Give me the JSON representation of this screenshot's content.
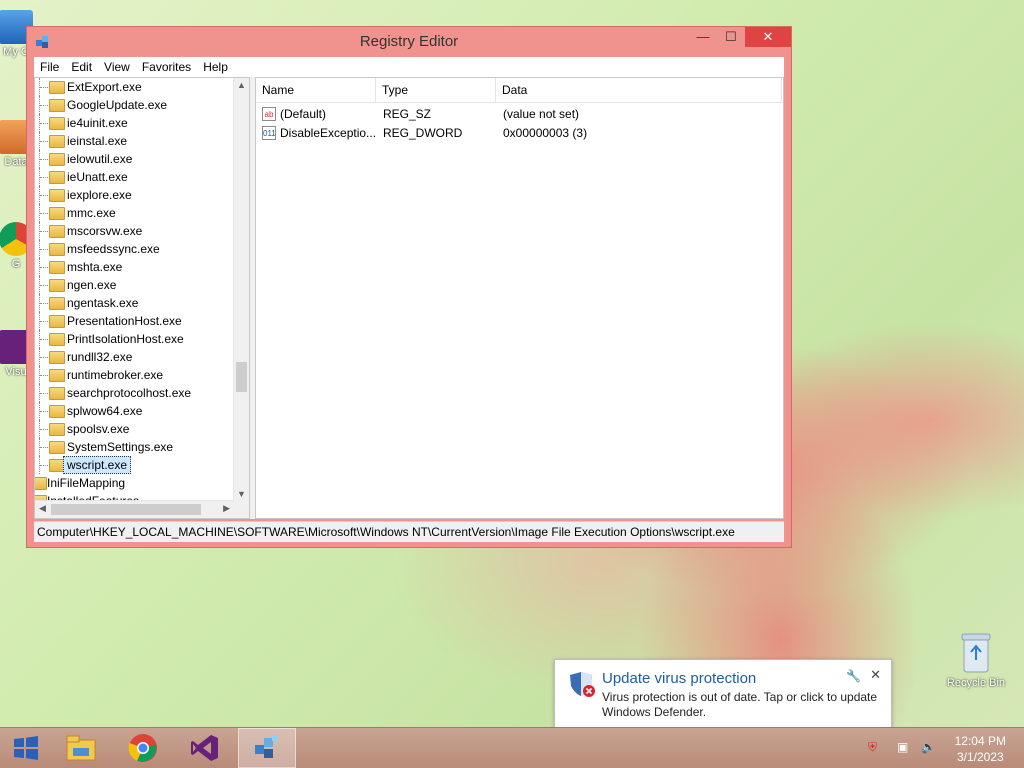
{
  "desktop": {
    "icons": [
      {
        "label": "My C",
        "name": "my-computer-icon"
      },
      {
        "label": "Data",
        "name": "data-icon"
      },
      {
        "label": "G",
        "name": "chrome-desktop-icon"
      },
      {
        "label": "Visu",
        "name": "visual-studio-desktop-icon"
      }
    ],
    "recycle_bin": "Recycle Bin"
  },
  "window": {
    "title": "Registry Editor",
    "buttons": {
      "minimize": "—",
      "maximize": "☐",
      "close": "✕"
    },
    "menu": [
      "File",
      "Edit",
      "View",
      "Favorites",
      "Help"
    ],
    "tree": {
      "items": [
        "ExtExport.exe",
        "GoogleUpdate.exe",
        "ie4uinit.exe",
        "ieinstal.exe",
        "ielowutil.exe",
        "ieUnatt.exe",
        "iexplore.exe",
        "mmc.exe",
        "mscorsvw.exe",
        "msfeedssync.exe",
        "mshta.exe",
        "ngen.exe",
        "ngentask.exe",
        "PresentationHost.exe",
        "PrintIsolationHost.exe",
        "rundll32.exe",
        "runtimebroker.exe",
        "searchprotocolhost.exe",
        "splwow64.exe",
        "spoolsv.exe",
        "SystemSettings.exe"
      ],
      "selected": "wscript.exe",
      "parent_items": [
        "IniFileMapping",
        "InstalledFeatures"
      ]
    },
    "list": {
      "columns": [
        "Name",
        "Type",
        "Data"
      ],
      "rows": [
        {
          "icon": "ab",
          "name": "(Default)",
          "type": "REG_SZ",
          "data": "(value not set)"
        },
        {
          "icon": "011",
          "name": "DisableExceptio...",
          "type": "REG_DWORD",
          "data": "0x00000003 (3)"
        }
      ]
    },
    "status_path": "Computer\\HKEY_LOCAL_MACHINE\\SOFTWARE\\Microsoft\\Windows NT\\CurrentVersion\\Image File Execution Options\\wscript.exe"
  },
  "notification": {
    "title": "Update virus protection",
    "body": "Virus protection is out of date. Tap or click to update Windows Defender."
  },
  "taskbar": {
    "time": "12:04 PM",
    "date": "3/1/2023"
  }
}
